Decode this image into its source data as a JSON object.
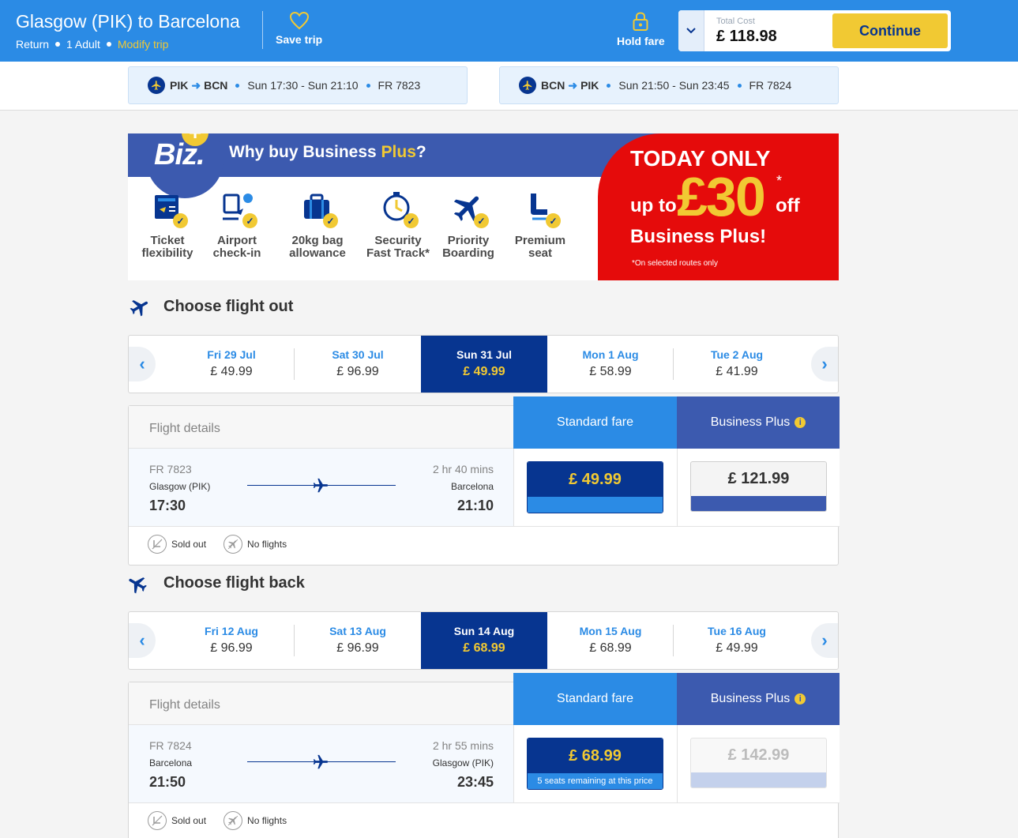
{
  "header": {
    "title": "Glasgow (PIK) to Barcelona",
    "trip_type": "Return",
    "passengers": "1 Adult",
    "modify_label": "Modify trip",
    "save_label": "Save trip",
    "hold_label": "Hold fare",
    "total_label": "Total Cost",
    "total_value": "£ 118.98",
    "continue_label": "Continue"
  },
  "legs": [
    {
      "from": "PIK",
      "to": "BCN",
      "times": "Sun 17:30 - Sun 21:10",
      "flight": "FR 7823"
    },
    {
      "from": "BCN",
      "to": "PIK",
      "times": "Sun 21:50 - Sun 23:45",
      "flight": "FR 7824"
    }
  ],
  "promo": {
    "logo": "Biz.",
    "headline_a": "Why buy Business ",
    "headline_b": "Plus",
    "headline_c": "?",
    "features": [
      {
        "line1": "Ticket",
        "line2": "flexibility",
        "icon": "ticket-icon"
      },
      {
        "line1": "Airport",
        "line2": "check-in",
        "icon": "checkin-icon"
      },
      {
        "line1": "20kg bag",
        "line2": "allowance",
        "icon": "bag-icon"
      },
      {
        "line1": "Security",
        "line2": "Fast Track*",
        "icon": "clock-icon"
      },
      {
        "line1": "Priority",
        "line2": "Boarding",
        "icon": "plane-icon"
      },
      {
        "line1": "Premium",
        "line2": "seat",
        "icon": "seat-icon"
      }
    ],
    "today": "TODAY ONLY",
    "up_to": "up to",
    "amount": "£30",
    "star": "*",
    "off": "off",
    "product": "Business Plus!",
    "fine_print": "*On selected routes only"
  },
  "outbound": {
    "title": "Choose flight out",
    "dates": [
      {
        "day": "Fri 29 Jul",
        "price": "£ 49.99"
      },
      {
        "day": "Sat 30 Jul",
        "price": "£ 96.99"
      },
      {
        "day": "Sun 31 Jul",
        "price": "£ 49.99"
      },
      {
        "day": "Mon 1 Aug",
        "price": "£ 58.99"
      },
      {
        "day": "Tue 2 Aug",
        "price": "£ 41.99"
      }
    ],
    "details_label": "Flight details",
    "std_label": "Standard fare",
    "biz_label": "Business Plus",
    "flight_no": "FR 7823",
    "duration": "2 hr 40 mins",
    "origin": "Glasgow (PIK)",
    "destination": "Barcelona",
    "depart": "17:30",
    "arrive": "21:10",
    "std_price": "£ 49.99",
    "std_note": "",
    "biz_price": "£ 121.99",
    "sold_out": "Sold out",
    "no_flights": "No flights"
  },
  "inbound": {
    "title": "Choose flight back",
    "dates": [
      {
        "day": "Fri 12 Aug",
        "price": "£ 96.99"
      },
      {
        "day": "Sat 13 Aug",
        "price": "£ 96.99"
      },
      {
        "day": "Sun 14 Aug",
        "price": "£ 68.99"
      },
      {
        "day": "Mon 15 Aug",
        "price": "£ 68.99"
      },
      {
        "day": "Tue 16 Aug",
        "price": "£ 49.99"
      }
    ],
    "details_label": "Flight details",
    "std_label": "Standard fare",
    "biz_label": "Business Plus",
    "flight_no": "FR 7824",
    "duration": "2 hr 55 mins",
    "origin": "Barcelona",
    "destination": "Glasgow (PIK)",
    "depart": "21:50",
    "arrive": "23:45",
    "std_price": "£ 68.99",
    "std_note": "5 seats remaining at this price",
    "biz_price": "£ 142.99",
    "sold_out": "Sold out",
    "no_flights": "No flights"
  },
  "colors": {
    "primary": "#073590",
    "accent": "#f1c933",
    "sky": "#2b8be5",
    "promo_red": "#e50b0b"
  }
}
